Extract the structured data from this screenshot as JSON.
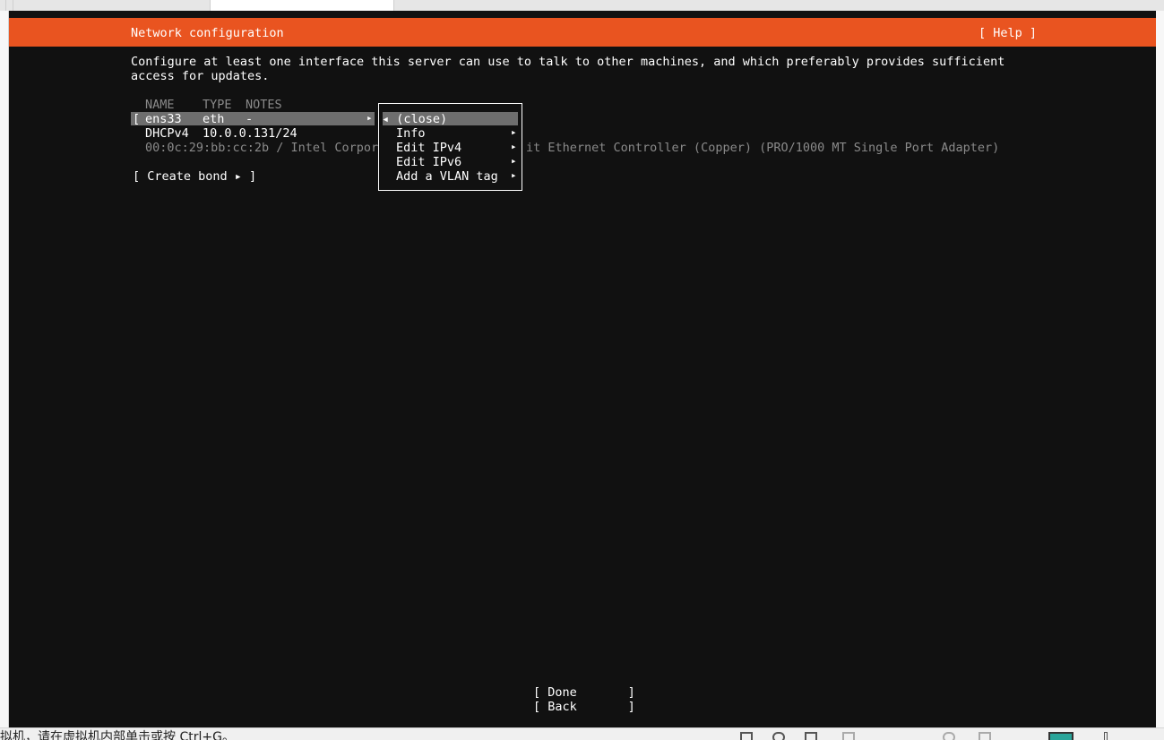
{
  "host": {
    "status_hint": "要将输入定向到该虚拟机，请在虚拟机内部单击或按 Ctrl+G。"
  },
  "installer": {
    "title": "Network configuration",
    "help": "[ Help ]",
    "description_line1": "Configure at least one interface this server can use to talk to other machines, and which preferably provides sufficient",
    "description_line2": "access for updates.",
    "table": {
      "headers": {
        "name": "NAME",
        "type": "TYPE",
        "notes": "NOTES"
      },
      "row": {
        "bracket": "[",
        "name": "ens33",
        "type": "eth",
        "notes": "-",
        "arrow": "▸"
      },
      "dhcp": {
        "label": "DHCPv4",
        "value": "10.0.0.131/24"
      },
      "mac_left": "00:0c:29:bb:cc:2b / Intel Corpor",
      "mac_right": "it Ethernet Controller (Copper) (PRO/1000 MT Single Port Adapter)"
    },
    "create_bond": "[ Create bond ▸ ]",
    "menu": {
      "close": "◂ (close)",
      "items": [
        {
          "label": "Info",
          "arrow": "▸"
        },
        {
          "label": "Edit IPv4",
          "arrow": "▸"
        },
        {
          "label": "Edit IPv6",
          "arrow": "▸"
        },
        {
          "label": "Add a VLAN tag",
          "arrow": "▸"
        }
      ]
    },
    "buttons": {
      "done": "[ Done       ]",
      "back": "[ Back       ]"
    },
    "colors": {
      "accent": "#e95420",
      "background": "#111111",
      "selection": "#6e6e6e"
    }
  }
}
